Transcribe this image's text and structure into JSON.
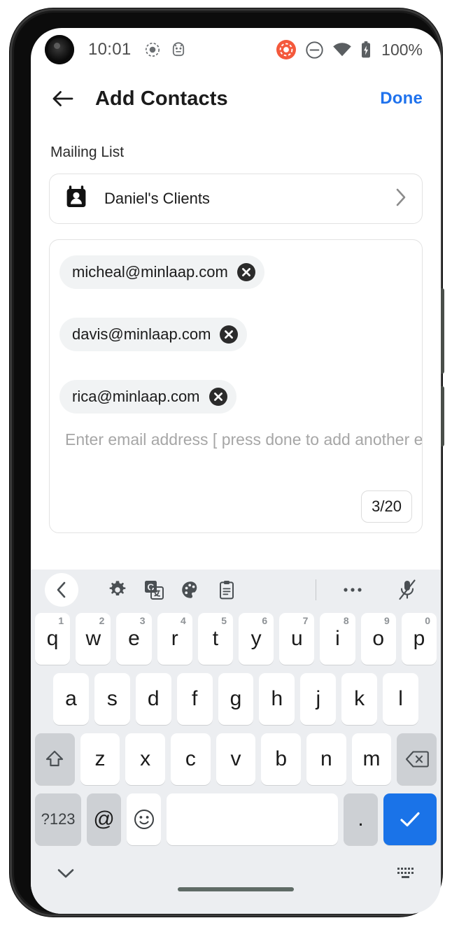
{
  "status_bar": {
    "time": "10:01",
    "battery_percent": "100%",
    "left_icons": [
      "screen-record-dot-icon",
      "android-bug-icon"
    ],
    "right_icons": [
      "screen-recording-active-icon",
      "do-not-disturb-icon",
      "wifi-icon",
      "battery-charging-icon"
    ],
    "recording_badge_color": "#f4593c"
  },
  "app_bar": {
    "back_icon": "arrow-left-icon",
    "title": "Add Contacts",
    "done_label": "Done",
    "done_color": "#1f72ed"
  },
  "content": {
    "mailing_list_label": "Mailing List",
    "mailing_list": {
      "icon": "contact-badge-icon",
      "name": "Daniel's Clients",
      "chevron": "chevron-right-icon"
    },
    "email_field": {
      "chips": [
        {
          "email": "micheal@minlaap.com",
          "remove_icon": "close-circle-icon"
        },
        {
          "email": "davis@minlaap.com",
          "remove_icon": "close-circle-icon"
        },
        {
          "email": "rica@minlaap.com",
          "remove_icon": "close-circle-icon"
        }
      ],
      "placeholder": "Enter email address [ press done to add another email ]",
      "counter": "3/20"
    }
  },
  "keyboard": {
    "toolbar": [
      {
        "name": "kb-back-button",
        "icon": "chevron-left-icon"
      },
      {
        "name": "kb-settings-button",
        "icon": "gear-icon"
      },
      {
        "name": "kb-translate-button",
        "icon": "translate-icon"
      },
      {
        "name": "kb-theme-button",
        "icon": "palette-icon"
      },
      {
        "name": "kb-clipboard-button",
        "icon": "clipboard-icon"
      },
      {
        "name": "kb-more-button",
        "icon": "more-horizontal-icon"
      },
      {
        "name": "kb-voice-button",
        "icon": "microphone-off-icon"
      }
    ],
    "row1": [
      {
        "letter": "q",
        "digit": "1"
      },
      {
        "letter": "w",
        "digit": "2"
      },
      {
        "letter": "e",
        "digit": "3"
      },
      {
        "letter": "r",
        "digit": "4"
      },
      {
        "letter": "t",
        "digit": "5"
      },
      {
        "letter": "y",
        "digit": "6"
      },
      {
        "letter": "u",
        "digit": "7"
      },
      {
        "letter": "i",
        "digit": "8"
      },
      {
        "letter": "o",
        "digit": "9"
      },
      {
        "letter": "p",
        "digit": "0"
      }
    ],
    "row2": [
      "a",
      "s",
      "d",
      "f",
      "g",
      "h",
      "j",
      "k",
      "l"
    ],
    "row3": [
      "z",
      "x",
      "c",
      "v",
      "b",
      "n",
      "m"
    ],
    "shift_icon": "shift-arrow-icon",
    "backspace_icon": "backspace-icon",
    "symbols_label": "?123",
    "at_label": "@",
    "emoji_icon": "smiley-icon",
    "space_label": "",
    "period_label": ".",
    "enter_icon": "check-icon",
    "enter_color": "#1a73e8",
    "nav": {
      "hide_icon": "chevron-down-icon",
      "switcher_icon": "keyboard-grid-icon"
    }
  }
}
